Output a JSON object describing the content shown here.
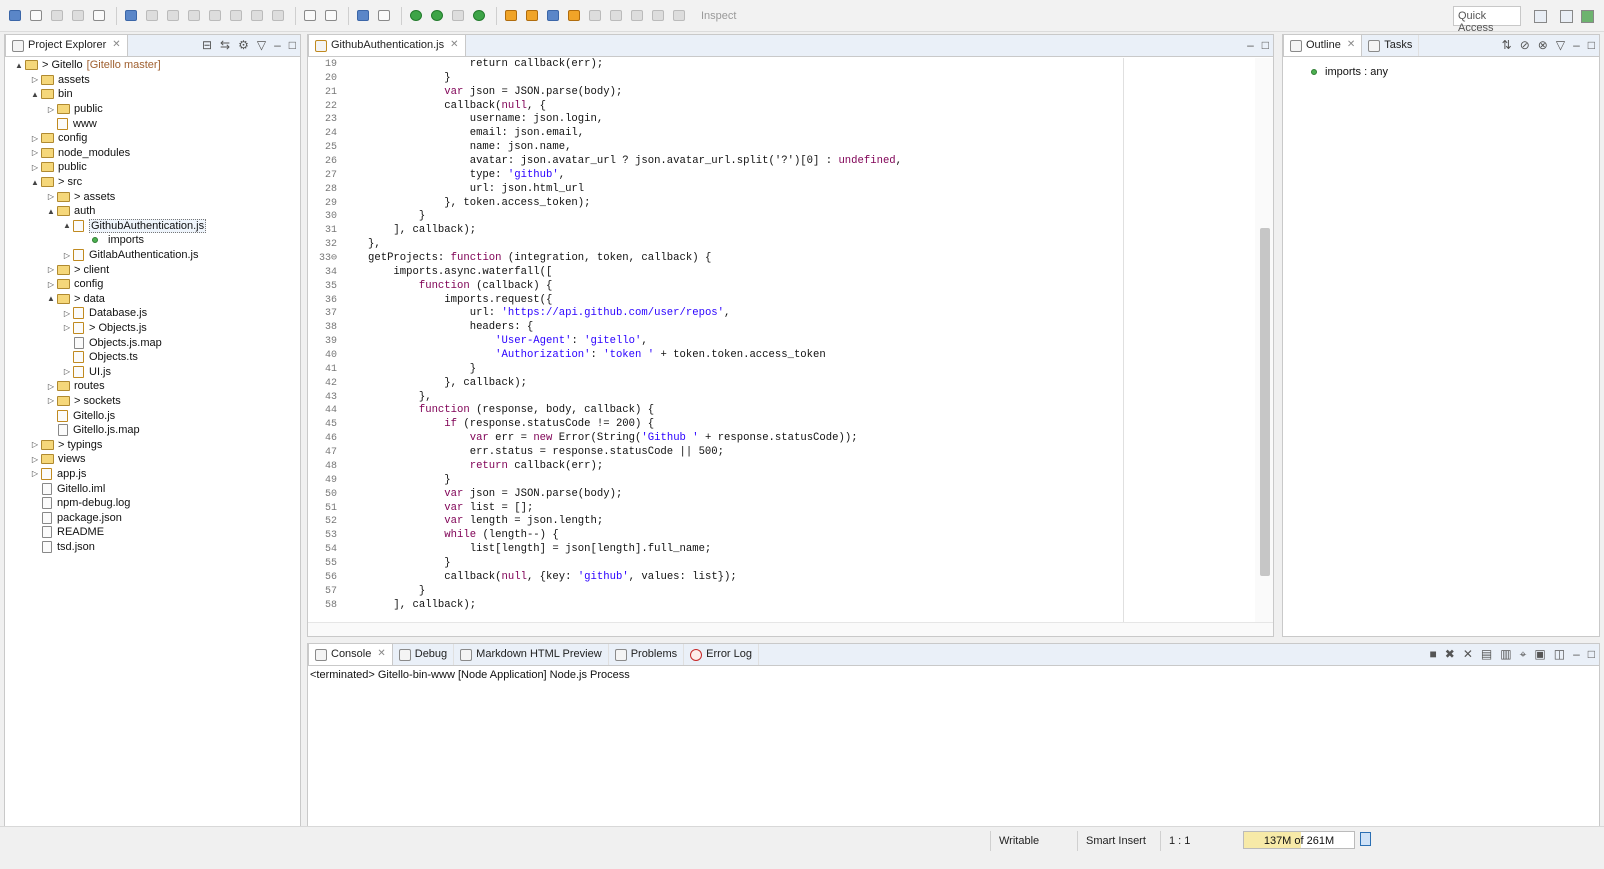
{
  "toolbar": {
    "inspect_label": "Inspect",
    "quick_access_placeholder": "Quick Access"
  },
  "project_explorer": {
    "tab_label": "Project Explorer",
    "rows": [
      {
        "indent": 0,
        "arrow": "▲",
        "kind": "folder",
        "label": "> Gitello",
        "branch": "[Gitello master]"
      },
      {
        "indent": 1,
        "arrow": "▷",
        "kind": "folder",
        "label": "assets"
      },
      {
        "indent": 1,
        "arrow": "▲",
        "kind": "folder",
        "label": "bin"
      },
      {
        "indent": 2,
        "arrow": "▷",
        "kind": "folder",
        "label": "public"
      },
      {
        "indent": 2,
        "arrow": "",
        "kind": "js",
        "label": "www"
      },
      {
        "indent": 1,
        "arrow": "▷",
        "kind": "folder",
        "label": "config"
      },
      {
        "indent": 1,
        "arrow": "▷",
        "kind": "folder",
        "label": "node_modules"
      },
      {
        "indent": 1,
        "arrow": "▷",
        "kind": "folder",
        "label": "public"
      },
      {
        "indent": 1,
        "arrow": "▲",
        "kind": "folder",
        "label": "> src"
      },
      {
        "indent": 2,
        "arrow": "▷",
        "kind": "folder",
        "label": "> assets"
      },
      {
        "indent": 2,
        "arrow": "▲",
        "kind": "folder",
        "label": "auth"
      },
      {
        "indent": 3,
        "arrow": "▲",
        "kind": "js",
        "label": "GithubAuthentication.js",
        "selected": true
      },
      {
        "indent": 4,
        "arrow": "",
        "kind": "dot",
        "label": "imports"
      },
      {
        "indent": 3,
        "arrow": "▷",
        "kind": "js",
        "label": "GitlabAuthentication.js"
      },
      {
        "indent": 2,
        "arrow": "▷",
        "kind": "folder",
        "label": "> client"
      },
      {
        "indent": 2,
        "arrow": "▷",
        "kind": "folder",
        "label": "config"
      },
      {
        "indent": 2,
        "arrow": "▲",
        "kind": "folder",
        "label": "> data"
      },
      {
        "indent": 3,
        "arrow": "▷",
        "kind": "js",
        "label": "Database.js"
      },
      {
        "indent": 3,
        "arrow": "▷",
        "kind": "js",
        "label": "> Objects.js"
      },
      {
        "indent": 3,
        "arrow": "",
        "kind": "file",
        "label": "Objects.js.map"
      },
      {
        "indent": 3,
        "arrow": "",
        "kind": "js",
        "label": "Objects.ts"
      },
      {
        "indent": 3,
        "arrow": "▷",
        "kind": "js",
        "label": "UI.js"
      },
      {
        "indent": 2,
        "arrow": "▷",
        "kind": "folder",
        "label": "routes"
      },
      {
        "indent": 2,
        "arrow": "▷",
        "kind": "folder",
        "label": "> sockets"
      },
      {
        "indent": 2,
        "arrow": "",
        "kind": "js",
        "label": "Gitello.js"
      },
      {
        "indent": 2,
        "arrow": "",
        "kind": "file",
        "label": "Gitello.js.map"
      },
      {
        "indent": 1,
        "arrow": "▷",
        "kind": "folder",
        "label": "> typings"
      },
      {
        "indent": 1,
        "arrow": "▷",
        "kind": "folder",
        "label": "views"
      },
      {
        "indent": 1,
        "arrow": "▷",
        "kind": "js",
        "label": "app.js"
      },
      {
        "indent": 1,
        "arrow": "",
        "kind": "file",
        "label": "Gitello.iml"
      },
      {
        "indent": 1,
        "arrow": "",
        "kind": "file",
        "label": "npm-debug.log"
      },
      {
        "indent": 1,
        "arrow": "",
        "kind": "file",
        "label": "package.json"
      },
      {
        "indent": 1,
        "arrow": "",
        "kind": "file",
        "label": "README"
      },
      {
        "indent": 1,
        "arrow": "",
        "kind": "file",
        "label": "tsd.json"
      }
    ]
  },
  "editor": {
    "tab_label": "GithubAuthentication.js",
    "line_numbers": [
      "19",
      "20",
      "21",
      "22",
      "23",
      "24",
      "25",
      "26",
      "27",
      "28",
      "29",
      "30",
      "31",
      "32",
      "33⊖",
      "34",
      "35",
      "36",
      "37",
      "38",
      "39",
      "40",
      "41",
      "42",
      "43",
      "44",
      "45",
      "46",
      "47",
      "48",
      "49",
      "50",
      "51",
      "52",
      "53",
      "54",
      "55",
      "56",
      "57",
      "58"
    ],
    "lines": [
      [
        [
          "",
          "                return callback(err);"
        ]
      ],
      [
        [
          "",
          "            }"
        ]
      ],
      [
        [
          "",
          "            "
        ],
        [
          "kw",
          "var"
        ],
        [
          "",
          " json = JSON.parse(body);"
        ]
      ],
      [
        [
          "",
          "            callback("
        ],
        [
          "kw",
          "null"
        ],
        [
          "",
          ", {"
        ]
      ],
      [
        [
          "",
          "                username: json.login,"
        ]
      ],
      [
        [
          "",
          "                email: json.email,"
        ]
      ],
      [
        [
          "",
          "                name: json.name,"
        ]
      ],
      [
        [
          "",
          "                avatar: json.avatar_url ? json.avatar_url.split('?')[0] : "
        ],
        [
          "kw",
          "undefined"
        ],
        [
          "",
          ","
        ]
      ],
      [
        [
          "",
          "                type: "
        ],
        [
          "str",
          "'github'"
        ],
        [
          "",
          ","
        ]
      ],
      [
        [
          "",
          "                url: json.html_url"
        ]
      ],
      [
        [
          "",
          "            }, token.access_token);"
        ]
      ],
      [
        [
          "",
          "        }"
        ]
      ],
      [
        [
          "",
          "    ], callback);"
        ]
      ],
      [
        [
          "",
          "},"
        ]
      ],
      [
        [
          "",
          "getProjects: "
        ],
        [
          "kw",
          "function"
        ],
        [
          "",
          " (integration, token, callback) {"
        ]
      ],
      [
        [
          "",
          "    imports.async.waterfall(["
        ]
      ],
      [
        [
          "",
          "        "
        ],
        [
          "kw",
          "function"
        ],
        [
          "",
          " (callback) {"
        ]
      ],
      [
        [
          "",
          "            imports.request({"
        ]
      ],
      [
        [
          "",
          "                url: "
        ],
        [
          "str",
          "'https://api.github.com/user/repos'"
        ],
        [
          "",
          ","
        ]
      ],
      [
        [
          "",
          "                headers: {"
        ]
      ],
      [
        [
          "",
          "                    "
        ],
        [
          "str",
          "'User-Agent'"
        ],
        [
          "",
          ": "
        ],
        [
          "str",
          "'gitello'"
        ],
        [
          "",
          ","
        ]
      ],
      [
        [
          "",
          "                    "
        ],
        [
          "str",
          "'Authorization'"
        ],
        [
          "",
          ": "
        ],
        [
          "str",
          "'token '"
        ],
        [
          "",
          " + token.token.access_token"
        ]
      ],
      [
        [
          "",
          "                }"
        ]
      ],
      [
        [
          "",
          "            }, callback);"
        ]
      ],
      [
        [
          "",
          "        },"
        ]
      ],
      [
        [
          "",
          "        "
        ],
        [
          "kw",
          "function"
        ],
        [
          "",
          " (response, body, callback) {"
        ]
      ],
      [
        [
          "",
          "            "
        ],
        [
          "kw",
          "if"
        ],
        [
          "",
          " (response.statusCode != 200) {"
        ]
      ],
      [
        [
          "",
          "                "
        ],
        [
          "kw",
          "var"
        ],
        [
          "",
          " err = "
        ],
        [
          "kw",
          "new"
        ],
        [
          "",
          " Error(String("
        ],
        [
          "str",
          "'Github '"
        ],
        [
          "",
          " + response.statusCode));"
        ]
      ],
      [
        [
          "",
          "                err.status = response.statusCode || 500;"
        ]
      ],
      [
        [
          "",
          "                "
        ],
        [
          "kw",
          "return"
        ],
        [
          "",
          " callback(err);"
        ]
      ],
      [
        [
          "",
          "            }"
        ]
      ],
      [
        [
          "",
          "            "
        ],
        [
          "kw",
          "var"
        ],
        [
          "",
          " json = JSON.parse(body);"
        ]
      ],
      [
        [
          "",
          "            "
        ],
        [
          "kw",
          "var"
        ],
        [
          "",
          " list = [];"
        ]
      ],
      [
        [
          "",
          "            "
        ],
        [
          "kw",
          "var"
        ],
        [
          "",
          " length = json.length;"
        ]
      ],
      [
        [
          "",
          "            "
        ],
        [
          "kw",
          "while"
        ],
        [
          "",
          " (length--) {"
        ]
      ],
      [
        [
          "",
          "                list[length] = json[length].full_name;"
        ]
      ],
      [
        [
          "",
          "            }"
        ]
      ],
      [
        [
          "",
          "            callback("
        ],
        [
          "kw",
          "null"
        ],
        [
          "",
          ", {key: "
        ],
        [
          "str",
          "'github'"
        ],
        [
          "",
          ", values: list});"
        ]
      ],
      [
        [
          "",
          "        }"
        ]
      ],
      [
        [
          "",
          "    ], callback);"
        ]
      ]
    ]
  },
  "outline": {
    "tab_label": "Outline",
    "tasks_label": "Tasks",
    "item_label": "imports : any"
  },
  "console": {
    "tabs": [
      "Console",
      "Debug",
      "Markdown HTML Preview",
      "Problems",
      "Error Log"
    ],
    "header": "<terminated> Gitello-bin-www [Node Application] Node.js Process"
  },
  "status": {
    "writable": "Writable",
    "insert_mode": "Smart Insert",
    "position": "1 : 1",
    "heap": "137M of 261M",
    "heap_used_fraction": 0.52
  }
}
